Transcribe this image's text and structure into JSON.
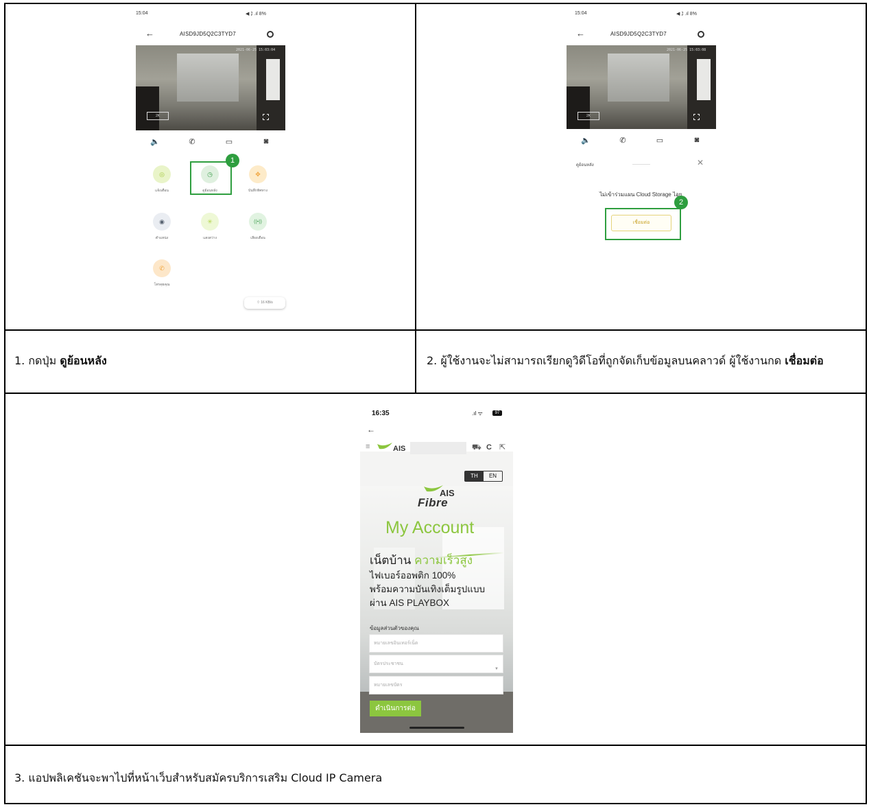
{
  "row1": {
    "left": {
      "phone": {
        "status_time": "15:04",
        "status_right": "◀ ⁒ .ıl 8%",
        "title": "AISD9JD5Q2C3TYD7",
        "video_timestamp": "2021-06-25 15:03:04",
        "video_quality": "2K",
        "functions": [
          {
            "label": "แจ้งเตือน",
            "icon": "bell-icon",
            "color": "#e9f4c9",
            "glyph": "◎"
          },
          {
            "label": "ดูย้อนหลัง",
            "icon": "history-icon",
            "color": "#dff0df",
            "glyph": "◷"
          },
          {
            "label": "บันทึกทิศทาง",
            "icon": "direction-icon",
            "color": "#fdebc9",
            "glyph": "✥"
          },
          {
            "label": "ตำแหน่ง",
            "icon": "location-icon",
            "color": "#eaedf2",
            "glyph": "◉"
          },
          {
            "label": "แสงสว่าง",
            "icon": "light-icon",
            "color": "#eef8d6",
            "glyph": "✳"
          },
          {
            "label": "เสียงเตือน",
            "icon": "siren-icon",
            "color": "#e1f3e1",
            "glyph": "((•))"
          },
          {
            "label": "โทรคุยคุณ",
            "icon": "call-icon",
            "color": "#fde7c9",
            "glyph": "✆"
          }
        ],
        "speed": "⌔ 16 KB/s",
        "step_badge": "1"
      },
      "caption_prefix": "1. กดปุ่ม ",
      "caption_bold": "ดูย้อนหลัง"
    },
    "right": {
      "phone": {
        "status_time": "15:04",
        "status_right": "◀ ⁒ .ıl 8%",
        "title": "AISD9JD5Q2C3TYD7",
        "video_timestamp": "2021-06-25 15:03:08",
        "video_quality": "2K",
        "playback_label": "ดูย้อนหลัง",
        "notice": "ไม่เข้าร่วมแผน Cloud Storage ไอย",
        "connect_label": "เชื่อมต่อ",
        "step_badge": "2"
      },
      "caption_prefix": "2. ผู้ใช้งานจะไม่สามารถเรียกดูวิดีโอที่ถูกจัดเก็บข้อมูลบนคลาวด์ ผู้ใช้งานกด ",
      "caption_bold": "เชื่อมต่อ"
    }
  },
  "row2": {
    "web": {
      "time": "16:35",
      "battery": "97",
      "logo": "AIS",
      "lang_th": "TH",
      "lang_en": "EN",
      "brand_ais": "AIS",
      "brand_fibre": "Fibre",
      "title": "My Account",
      "headline_black": "เน็ตบ้าน ",
      "headline_green": "ความเร็วสูง",
      "sub_lines": [
        "ไฟเบอร์ออพติก 100%",
        "พร้อมความบันเทิงเต็มรูปแบบ",
        "ผ่าน AIS PLAYBOX"
      ],
      "form_title": "ข้อมูลส่วนตัวของคุณ",
      "field_internet_placeholder": "หมายเลขอินเทอร์เน็ต",
      "field_id_type": "บัตรประชาชน",
      "field_id_number_placeholder": "หมายเลขบัตร",
      "submit_label": "ดำเนินการต่อ"
    },
    "caption": "3. แอปพลิเคชันจะพาไปที่หน้าเว็บสำหรับสมัครบริการเสริม Cloud IP Camera"
  },
  "colors": {
    "accent_green": "#2e9e3f",
    "ais_green": "#8cc63f",
    "connect_yellow": "#e5d37b"
  }
}
